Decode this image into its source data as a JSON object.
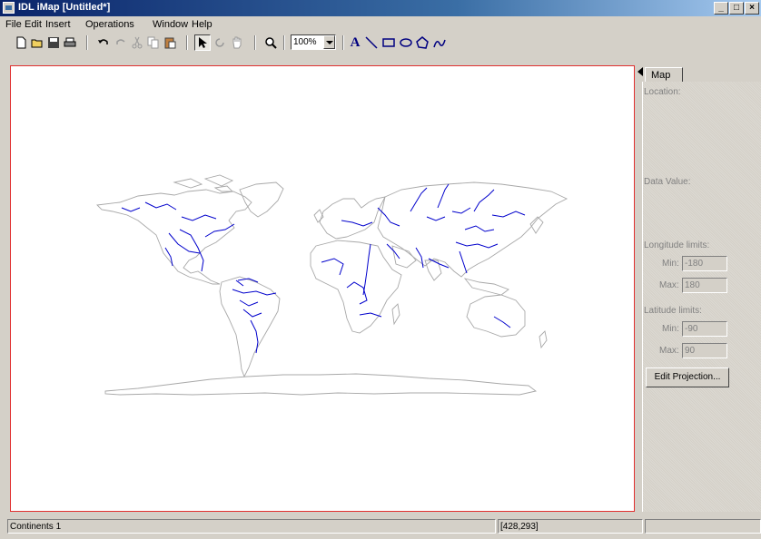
{
  "window": {
    "title": "IDL iMap [Untitled*]",
    "minimize": "_",
    "restore": "□",
    "close": "×"
  },
  "menu": [
    "File",
    "Edit",
    "Insert",
    "Operations",
    "Window",
    "Help"
  ],
  "toolbar": {
    "icons": [
      "new-file-icon",
      "open-folder-icon",
      "save-icon",
      "print-icon",
      "undo-icon",
      "redo-icon",
      "cut-icon",
      "copy-icon",
      "paste-icon",
      "select-arrow-icon",
      "rotate-icon",
      "pan-hand-icon",
      "zoom-magnifier-icon",
      "text-tool-icon",
      "line-tool-icon",
      "rectangle-tool-icon",
      "oval-tool-icon",
      "polygon-tool-icon",
      "freehand-tool-icon"
    ],
    "zoom_value": "100%",
    "text_glyph": "A"
  },
  "panel": {
    "tab": "Map",
    "location_label": "Location:",
    "data_value_label": "Data Value:",
    "longitude_label": "Longitude limits:",
    "lon_min_label": "Min:",
    "lon_min": "-180",
    "lon_max_label": "Max:",
    "lon_max": "180",
    "latitude_label": "Latitude limits:",
    "lat_min_label": "Min:",
    "lat_min": "-90",
    "lat_max_label": "Max:",
    "lat_max": "90",
    "edit_projection": "Edit Projection..."
  },
  "status": {
    "left": "Continents 1",
    "coords": "[428,293]"
  },
  "colors": {
    "coastline": "#a0a0a0",
    "rivers": "#0000cc",
    "canvas_border": "#e03030"
  }
}
